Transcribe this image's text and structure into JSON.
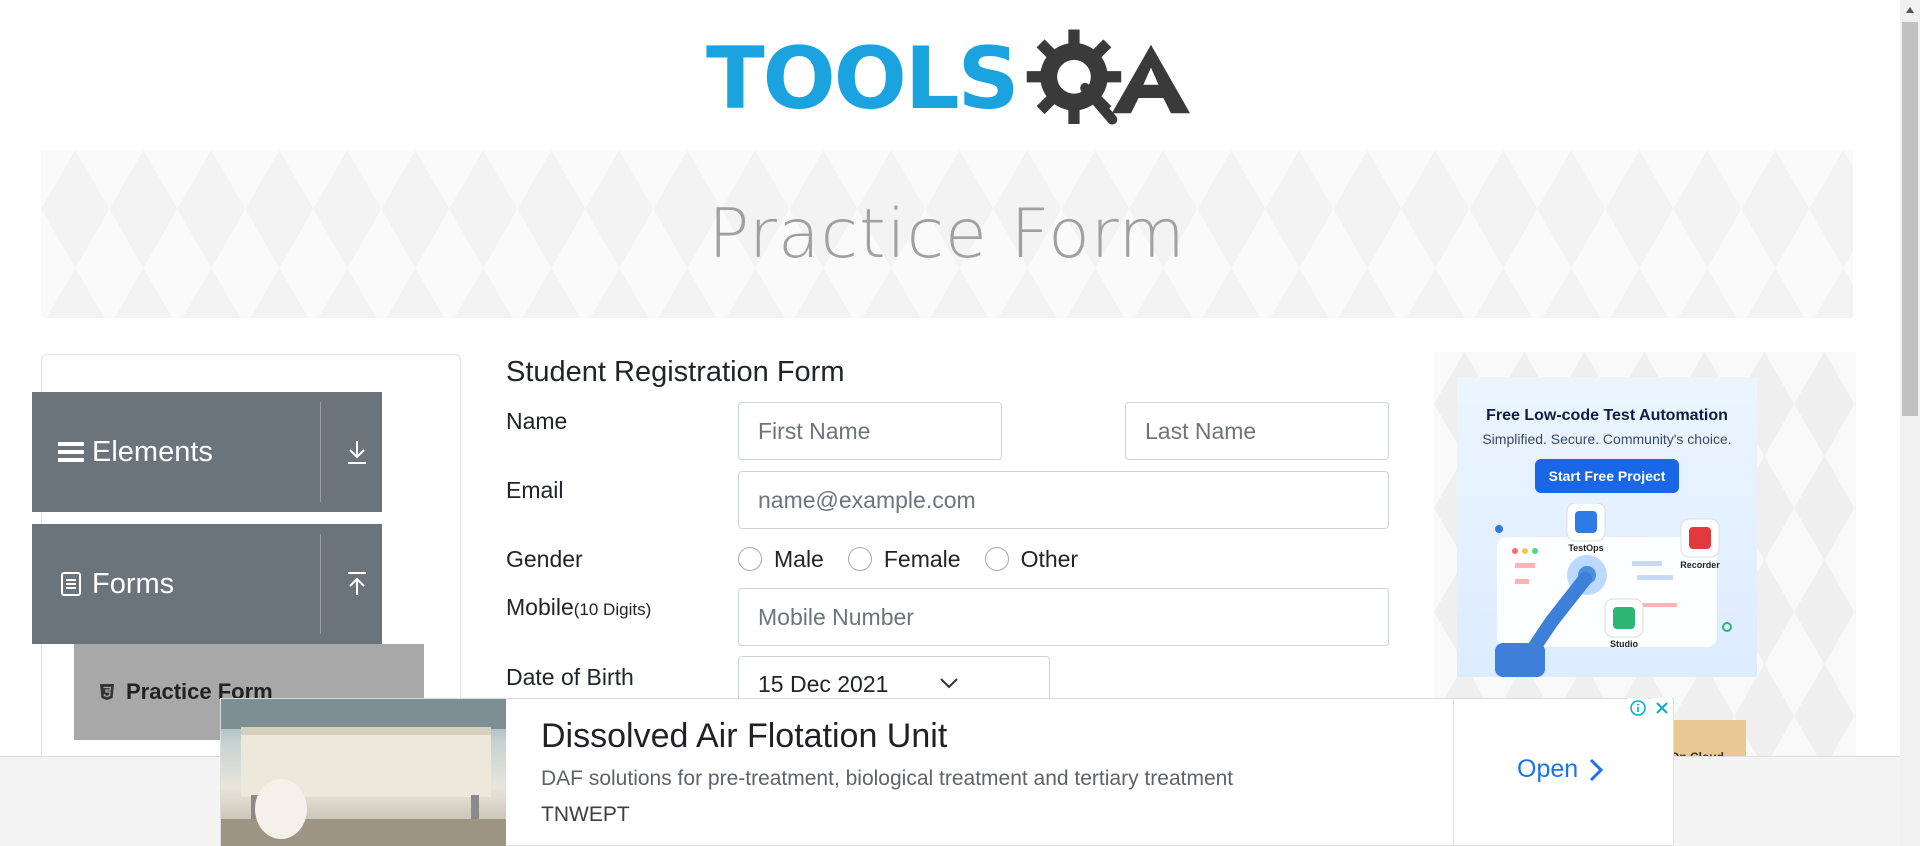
{
  "logo": {
    "text": "TOOLS",
    "brand": "TOOLSQA",
    "accent": "#1aa3de"
  },
  "banner": {
    "title": "Practice Form"
  },
  "sidebar": {
    "groups": [
      {
        "label": "Elements",
        "icon": "menu-icon",
        "toggle_icon": "download-arrow-icon"
      },
      {
        "label": "Forms",
        "icon": "document-icon",
        "toggle_icon": "upload-arrow-icon"
      }
    ],
    "active_item": {
      "label": "Practice Form",
      "icon": "html5-icon"
    }
  },
  "form": {
    "title": "Student Registration Form",
    "name_label": "Name",
    "first_name_placeholder": "First Name",
    "last_name_placeholder": "Last Name",
    "email_label": "Email",
    "email_placeholder": "name@example.com",
    "gender_label": "Gender",
    "gender_options": [
      "Male",
      "Female",
      "Other"
    ],
    "mobile_label": "Mobile",
    "mobile_hint": "(10 Digits)",
    "mobile_placeholder": "Mobile Number",
    "dob_label": "Date of Birth",
    "dob_value": "15 Dec 2021"
  },
  "right_ad": {
    "title": "Free Low-code Test Automation",
    "subtitle": "Simplified. Secure. Community's choice.",
    "button": "Start Free Project",
    "products": [
      "TestOps",
      "Recorder",
      "Studio"
    ],
    "peek_text": "On Cloud"
  },
  "bottom_ad": {
    "headline": "Dissolved Air Flotation Unit",
    "description": "DAF solutions for pre-treatment, biological treatment and tertiary treatment",
    "advertiser": "TNWEPT",
    "cta": "Open"
  }
}
